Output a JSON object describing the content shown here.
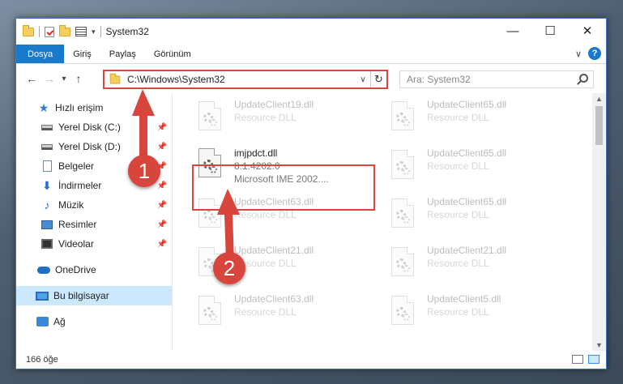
{
  "window": {
    "title": "System32",
    "minimize": "—",
    "maximize": "☐",
    "close": "✕"
  },
  "ribbon": {
    "tabs": [
      "Dosya",
      "Giriş",
      "Paylaş",
      "Görünüm"
    ],
    "help": "?"
  },
  "navigation": {
    "back": "←",
    "forward": "→",
    "recent": "▾",
    "up": "↑",
    "address": "C:\\Windows\\System32",
    "refresh": "↻",
    "search_placeholder": "Ara: System32"
  },
  "sidebar": {
    "items": [
      {
        "label": "Hızlı erişim",
        "icon": "star-icon"
      },
      {
        "label": "Yerel Disk (C:)",
        "icon": "drive-icon",
        "pinned": true
      },
      {
        "label": "Yerel Disk (D:)",
        "icon": "drive-icon",
        "pinned": true
      },
      {
        "label": "Belgeler",
        "icon": "documents-icon",
        "pinned": true
      },
      {
        "label": "İndirmeler",
        "icon": "downloads-icon",
        "pinned": true
      },
      {
        "label": "Müzik",
        "icon": "music-icon",
        "pinned": true
      },
      {
        "label": "Resimler",
        "icon": "pictures-icon",
        "pinned": true
      },
      {
        "label": "Videolar",
        "icon": "videos-icon",
        "pinned": true
      },
      {
        "label": "OneDrive",
        "icon": "cloud-icon"
      },
      {
        "label": "Bu bilgisayar",
        "icon": "computer-icon",
        "selected": true
      },
      {
        "label": "Ağ",
        "icon": "network-icon"
      }
    ]
  },
  "files": {
    "left": [
      {
        "name": "UpdateClient19.dll",
        "type": "Resource DLL"
      },
      {
        "name": "imjpdct.dll",
        "type": "8.1.4202.0",
        "desc": "Microsoft IME 2002...."
      },
      {
        "name": "UpdateClient63.dll",
        "type": "Resource DLL"
      },
      {
        "name": "UpdateClient21.dll",
        "type": "Resource DLL"
      },
      {
        "name": "UpdateClient63.dll",
        "type": "Resource DLL"
      }
    ],
    "right": [
      {
        "name": "UpdateClient65.dll",
        "type": "Resource DLL"
      },
      {
        "name": "UpdateClient65.dll",
        "type": "Resource DLL"
      },
      {
        "name": "UpdateClient65.dll",
        "type": "Resource DLL"
      },
      {
        "name": "UpdateClient21.dll",
        "type": "Resource DLL"
      },
      {
        "name": "UpdateClient5.dll",
        "type": "Resource DLL"
      }
    ]
  },
  "status": {
    "count": "166 öğe"
  },
  "annotations": {
    "badge1": "1",
    "badge2": "2",
    "color": "#d8453c"
  }
}
